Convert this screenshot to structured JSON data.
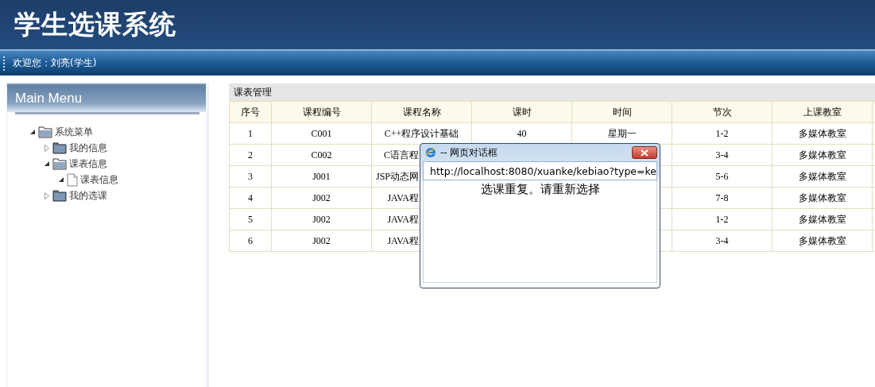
{
  "header": {
    "title": "学生选课系统",
    "welcome": "欢迎您：刘亮(学生)"
  },
  "sidebar": {
    "title": "Main Menu",
    "tree": [
      {
        "label": "系统菜单",
        "kind": "folder",
        "expanded": true,
        "children": [
          {
            "label": "我的信息",
            "kind": "folder",
            "expanded": false
          },
          {
            "label": "课表信息",
            "kind": "folder",
            "expanded": true,
            "children": [
              {
                "label": "课表信息",
                "kind": "file",
                "expanded": true
              }
            ]
          },
          {
            "label": "我的选课",
            "kind": "folder",
            "expanded": false
          }
        ]
      }
    ]
  },
  "table": {
    "title": "课表管理",
    "columns": [
      "序号",
      "课程编号",
      "课程名称",
      "课时",
      "时间",
      "节次",
      "上课教室"
    ],
    "rows": [
      {
        "index": "1",
        "code": "C001",
        "name": "C++程序设计基础",
        "hours": "40",
        "time": "星期一",
        "period": "1-2",
        "room": "多媒体教室"
      },
      {
        "index": "2",
        "code": "C002",
        "name": "C语言程",
        "period": "3-4",
        "room": "多媒体教室"
      },
      {
        "index": "3",
        "code": "J001",
        "name": "JSP动态网",
        "period": "5-6",
        "room": "多媒体教室"
      },
      {
        "index": "4",
        "code": "J002",
        "name": "JAVA程",
        "period": "7-8",
        "room": "多媒体教室"
      },
      {
        "index": "5",
        "code": "J002",
        "name": "JAVA程",
        "period": "1-2",
        "room": "多媒体教室"
      },
      {
        "index": "6",
        "code": "J002",
        "name": "JAVA程",
        "period": "3-4",
        "room": "多媒体教室"
      }
    ]
  },
  "dialog": {
    "title": "-- 网页对话框",
    "url": "http://localhost:8080/xuanke/kebiao?type=ke",
    "message": "选课重复。请重新选择"
  }
}
